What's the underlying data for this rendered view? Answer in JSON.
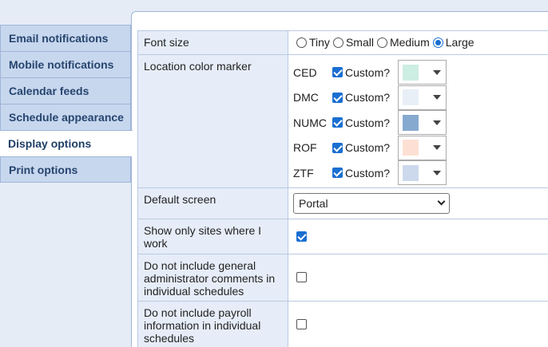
{
  "sidebar": {
    "items": [
      {
        "label": "Email notifications"
      },
      {
        "label": "Mobile notifications"
      },
      {
        "label": "Calendar feeds"
      },
      {
        "label": "Schedule appearance"
      },
      {
        "label": "Display options"
      },
      {
        "label": "Print options"
      }
    ],
    "active_index": 4
  },
  "settings": {
    "font_size": {
      "label": "Font size",
      "options": [
        "Tiny",
        "Small",
        "Medium",
        "Large"
      ],
      "selected": "Large"
    },
    "location_color": {
      "label": "Location color marker",
      "custom_label": "Custom?",
      "locations": [
        {
          "code": "CED",
          "custom": true,
          "color": "#cdeee2"
        },
        {
          "code": "DMC",
          "custom": true,
          "color": "#e8eff7"
        },
        {
          "code": "NUMC",
          "custom": true,
          "color": "#86a9d0"
        },
        {
          "code": "ROF",
          "custom": true,
          "color": "#fde0d3"
        },
        {
          "code": "ZTF",
          "custom": true,
          "color": "#ccd9ec"
        }
      ]
    },
    "default_screen": {
      "label": "Default screen",
      "value": "Portal"
    },
    "show_only_sites": {
      "label": "Show only sites where I work",
      "checked": true
    },
    "exclude_admin_comments": {
      "label": "Do not include general administrator comments in individual schedules",
      "checked": false
    },
    "exclude_payroll": {
      "label": "Do not include payroll information in individual schedules",
      "checked": false
    }
  }
}
